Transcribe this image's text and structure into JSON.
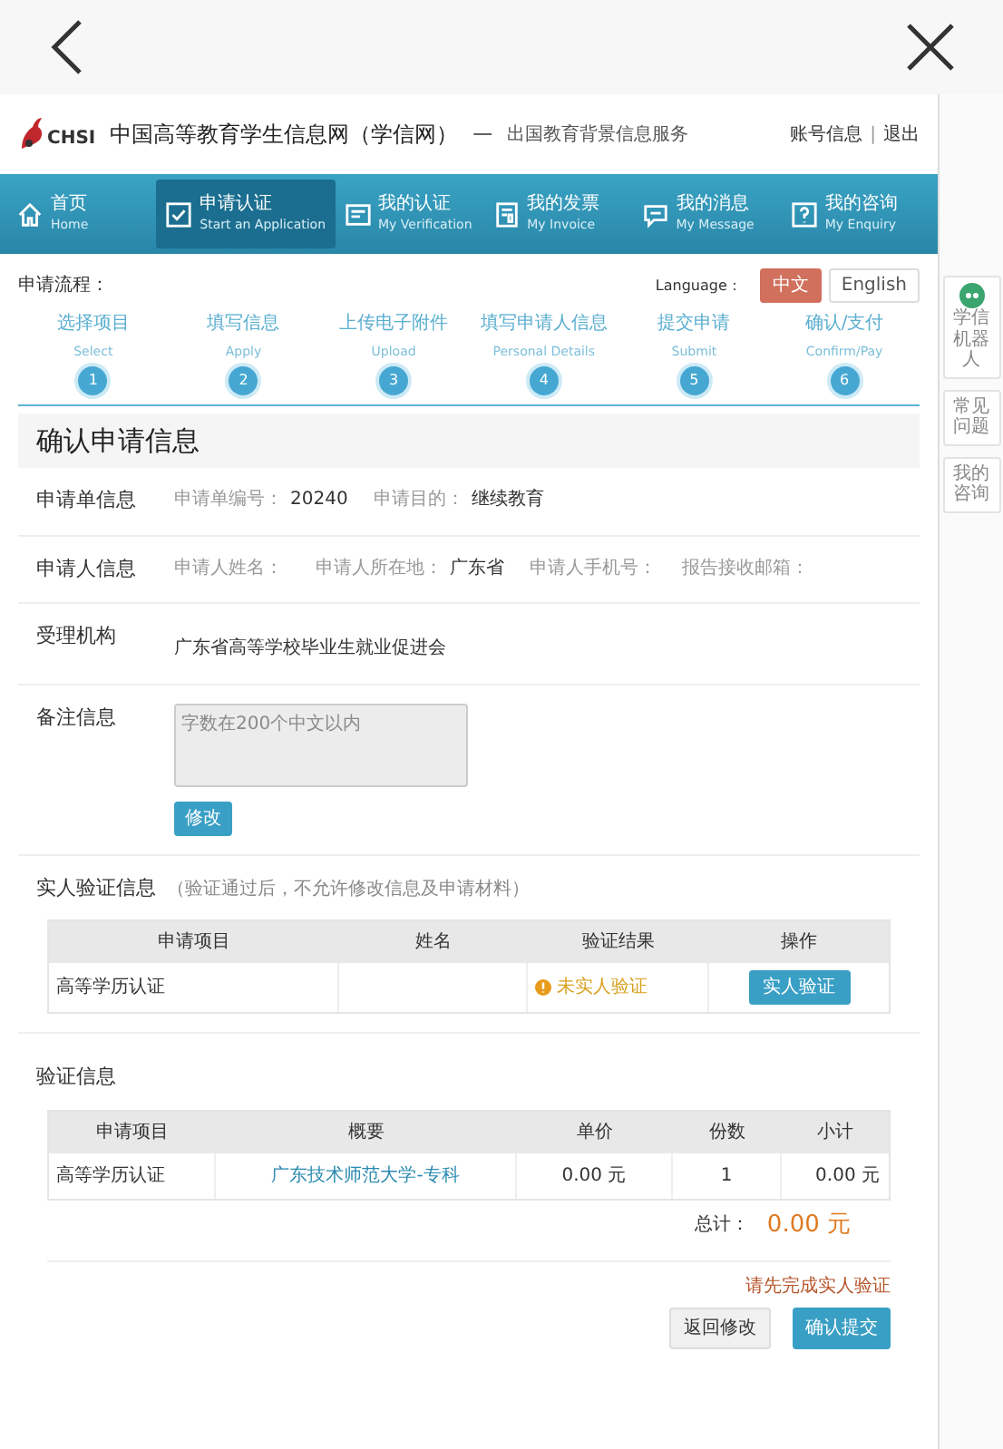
{
  "header": {
    "logo_text": "CHSI",
    "title": "中国高等教育学生信息网（学信网）",
    "dash": "—",
    "subtitle": "出国教育背景信息服务",
    "account_links": [
      "账号信息",
      "退出"
    ],
    "separator": "|"
  },
  "nav": [
    {
      "zh": "首页",
      "en": "Home",
      "selected": false
    },
    {
      "zh": "申请认证",
      "en": "Start an Application",
      "selected": true
    },
    {
      "zh": "我的认证",
      "en": "My Verification",
      "selected": false
    },
    {
      "zh": "我的发票",
      "en": "My Invoice",
      "selected": false
    },
    {
      "zh": "我的消息",
      "en": "My Message",
      "selected": false
    },
    {
      "zh": "我的咨询",
      "en": "My Enquiry",
      "selected": false
    }
  ],
  "process": {
    "label": "申请流程：",
    "language_label": "Language：",
    "languages": [
      {
        "label": "中文",
        "selected": true
      },
      {
        "label": "English",
        "selected": false
      }
    ],
    "steps": [
      {
        "zh": "选择项目",
        "en": "Select",
        "number": "1"
      },
      {
        "zh": "填写信息",
        "en": "Apply",
        "number": "2"
      },
      {
        "zh": "上传电子附件",
        "en": "Upload",
        "number": "3"
      },
      {
        "zh": "填写申请人信息",
        "en": "Personal Details",
        "number": "4"
      },
      {
        "zh": "提交申请",
        "en": "Submit",
        "number": "5"
      },
      {
        "zh": "确认/支付",
        "en": "Confirm/Pay",
        "number": "6"
      }
    ]
  },
  "page_title": "确认申请信息",
  "sections": [
    {
      "kind": "fields",
      "title": "申请单信息",
      "fields": [
        {
          "label": "申请单编号：",
          "value": "20240"
        },
        {
          "label": "申请目的：",
          "value": "继续教育"
        }
      ]
    },
    {
      "kind": "fields",
      "title": "申请人信息",
      "fields": [
        {
          "label": "申请人姓名："
        },
        {
          "label": "申请人所在地：",
          "value": "广东省"
        },
        {
          "label": "申请人手机号："
        },
        {
          "label": "报告接收邮箱："
        }
      ]
    },
    {
      "kind": "text",
      "title": "受理机构",
      "text": "广东省高等学校毕业生就业促进会"
    },
    {
      "kind": "remark",
      "title": "备注信息",
      "placeholder": "字数在200个中文以内",
      "button": "修改"
    }
  ],
  "identity": {
    "title": "实人验证信息",
    "note": "（验证通过后，不允许修改信息及申请材料）",
    "columns": [
      "申请项目",
      "姓名",
      "验证结果",
      "操作"
    ],
    "rows": [
      {
        "item": "高等学历认证",
        "result": "未实人验证",
        "verified": false,
        "action": "实人验证"
      }
    ]
  },
  "verification": {
    "title": "验证信息",
    "columns": [
      "申请项目",
      "概要",
      "单价",
      "份数",
      "小计"
    ],
    "rows": [
      {
        "item": "高等学历认证",
        "summary": "广东技术师范大学-专科",
        "price": "0.00 元",
        "count": "1",
        "subtotal": "0.00 元"
      }
    ],
    "total_label": "总计：",
    "total": "0.00 元"
  },
  "warning": "请先完成实人验证",
  "buttons": [
    {
      "label": "返回修改",
      "kind": "secondary"
    },
    {
      "label": "确认提交",
      "kind": "primary"
    }
  ],
  "side_tools": [
    {
      "label": "学信机器人",
      "kind": "robot"
    },
    {
      "label": "常见问题",
      "kind": "text"
    },
    {
      "label": "我的咨询",
      "kind": "text"
    }
  ]
}
